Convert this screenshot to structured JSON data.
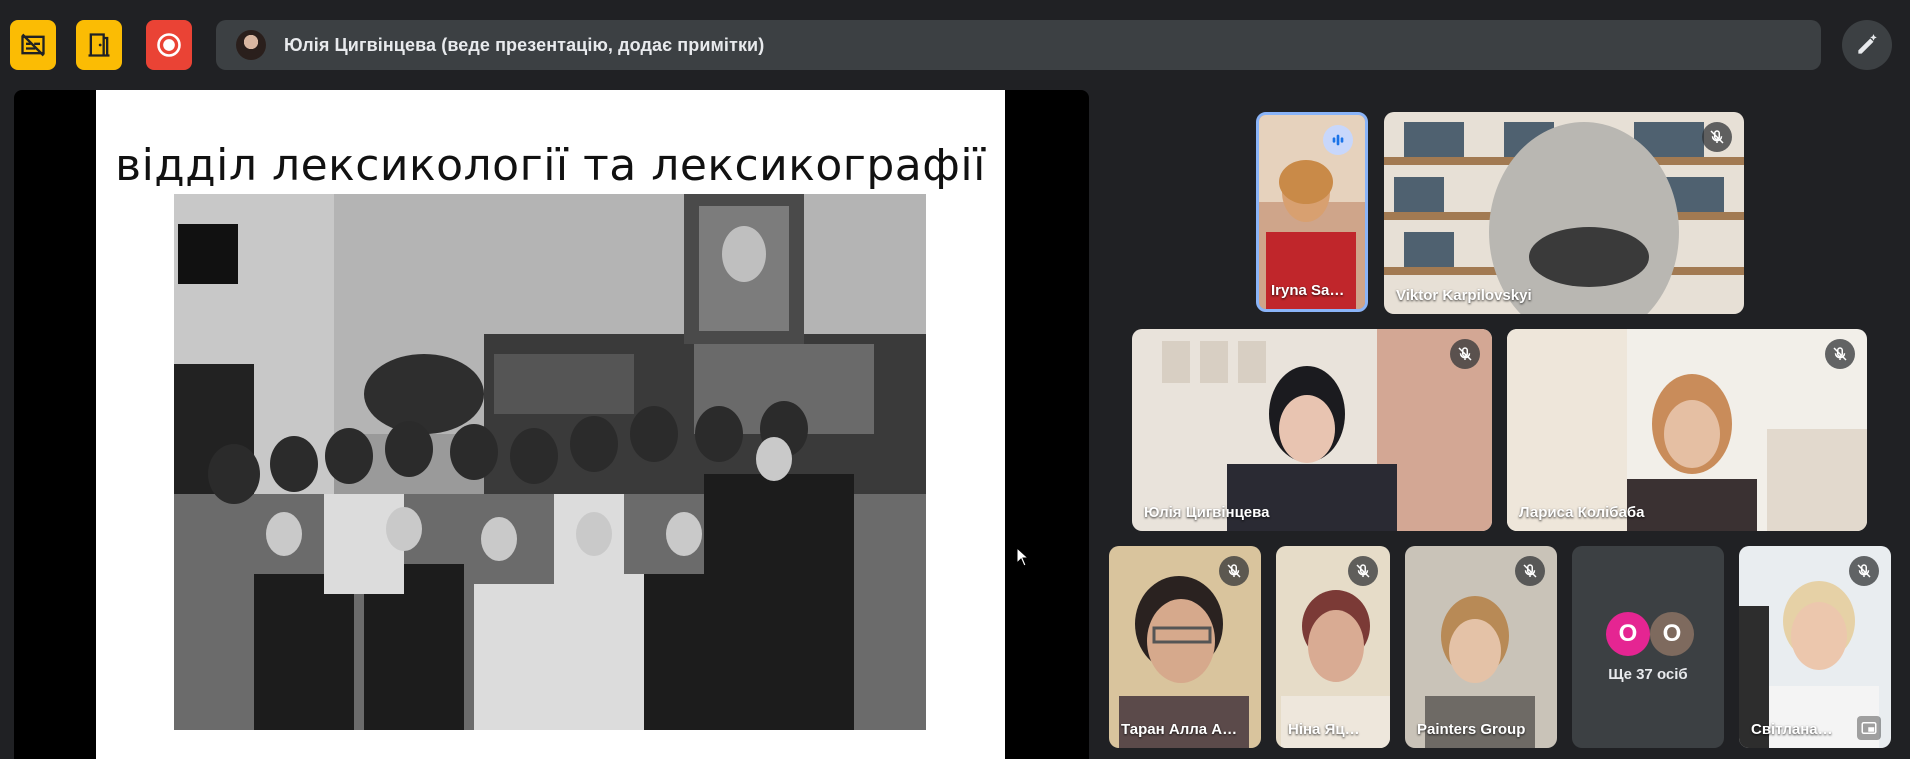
{
  "toolbar": {
    "icons": [
      "captions-off-icon",
      "door-icon",
      "record-icon"
    ],
    "colors": {
      "yellow": "#fbbc04",
      "red": "#ea4335"
    }
  },
  "presenter_bar": {
    "text": "Юлія Цигвінцева (веде презентацію, додає примітки)"
  },
  "slide": {
    "title": "відділ лексикології та лексикографії"
  },
  "participants": [
    {
      "name": "Iryna Sa…",
      "state": "speaking"
    },
    {
      "name": "Viktor Karpilovskyi",
      "state": "muted"
    },
    {
      "name": "Юлія Цигвінцева",
      "state": "muted"
    },
    {
      "name": "Лариса Колібаба",
      "state": "muted"
    },
    {
      "name": "Таран Алла А…",
      "state": "muted"
    },
    {
      "name": "Ніна Яц…",
      "state": "muted"
    },
    {
      "name": "Painters Group",
      "state": "muted"
    },
    {
      "name": "Світлана…",
      "state": "muted"
    }
  ],
  "more": {
    "avatar_letters": [
      "О",
      "О"
    ],
    "label": "Ще 37 осіб"
  }
}
